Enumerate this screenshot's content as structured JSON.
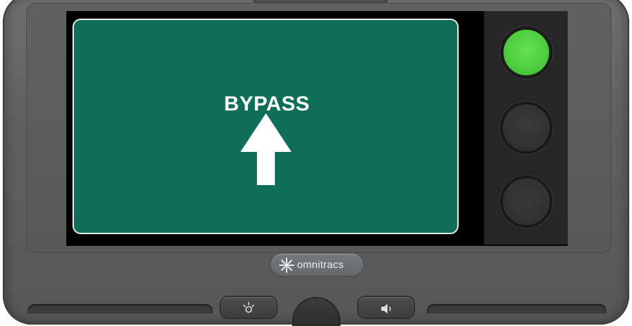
{
  "sign": {
    "title": "BYPASS",
    "arrow_icon": "arrow-up-icon",
    "background_color": "#0f6e58",
    "text_color": "#ffffff"
  },
  "status_lights": [
    {
      "state": "on",
      "color": "#4fcf3f"
    },
    {
      "state": "off",
      "color": "#323232"
    },
    {
      "state": "off",
      "color": "#323232"
    }
  ],
  "brand": {
    "logo_text": "omnitracs",
    "logo_icon": "omnitracs-logo-icon"
  },
  "hardware_buttons": [
    {
      "icon": "brightness-icon"
    },
    {
      "icon": "select-knob"
    },
    {
      "icon": "volume-icon"
    }
  ]
}
